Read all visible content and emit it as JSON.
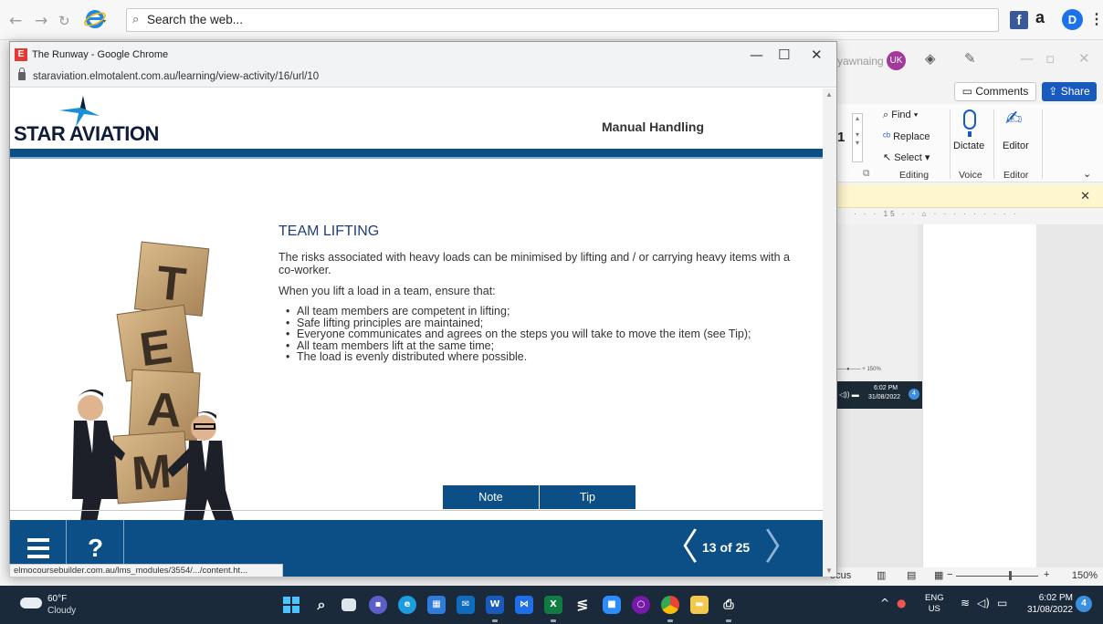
{
  "bg_browser": {
    "search_placeholder": "Search the web...",
    "ext_facebook": "f",
    "ext_amazon": "a",
    "ext_d": "D"
  },
  "word": {
    "user_name": "yawnaing",
    "user_initials": "UK",
    "comments_label": "Comments",
    "share_label": "Share",
    "font_size_value": "1",
    "find_label": "Find",
    "replace_label": "Replace",
    "select_label": "Select",
    "dictate_label": "Dictate",
    "editor_label": "Editor",
    "group_editing": "Editing",
    "group_voice": "Voice",
    "group_editor": "Editor",
    "ruler_text": "15",
    "thumb_zoom": "150%",
    "thumb_time": "6:02 PM",
    "thumb_date": "31/08/2022",
    "thumb_badge": "4",
    "status_focus": "ocus",
    "status_zoom": "150%"
  },
  "chrome": {
    "window_title": "The Runway - Google Chrome",
    "favicon_letter": "E",
    "url": "staraviation.elmotalent.com.au/learning/view-activity/16/url/10",
    "link_tooltip": "elmocoursebuilder.com.au/lms_modules/3554/.../content.ht..."
  },
  "course": {
    "logo_text": "STAR AVIATION",
    "module_title": "Manual Handling",
    "lesson_heading": "TEAM LIFTING",
    "intro": "The risks associated with heavy loads can be minimised by lifting and / or carrying heavy items with a co-worker.",
    "lead_in": "When you lift a load in a team, ensure that:",
    "bullets": [
      "All team members are competent in lifting;",
      "Safe lifting principles are maintained;",
      "Everyone communicates and agrees on the steps you will take to move the item (see Tip);",
      "All team members lift at the same time;",
      "The load is evenly distributed where possible."
    ],
    "illustration_letters": [
      "T",
      "E",
      "A",
      "M"
    ],
    "note_button": "Note",
    "tip_button": "Tip",
    "help_label": "?",
    "page_indicator": "13 of 25"
  },
  "taskbar": {
    "weather_temp": "60°F",
    "weather_desc": "Cloudy",
    "lang_line1": "ENG",
    "lang_line2": "US",
    "time": "6:02 PM",
    "date": "31/08/2022",
    "notification_count": "4",
    "apps": [
      "start",
      "search",
      "task-view",
      "teams",
      "edge",
      "store",
      "mail",
      "word",
      "visual-studio",
      "excel",
      "slack",
      "zoom",
      "onenote",
      "chrome",
      "file-explorer",
      "snipping"
    ]
  }
}
